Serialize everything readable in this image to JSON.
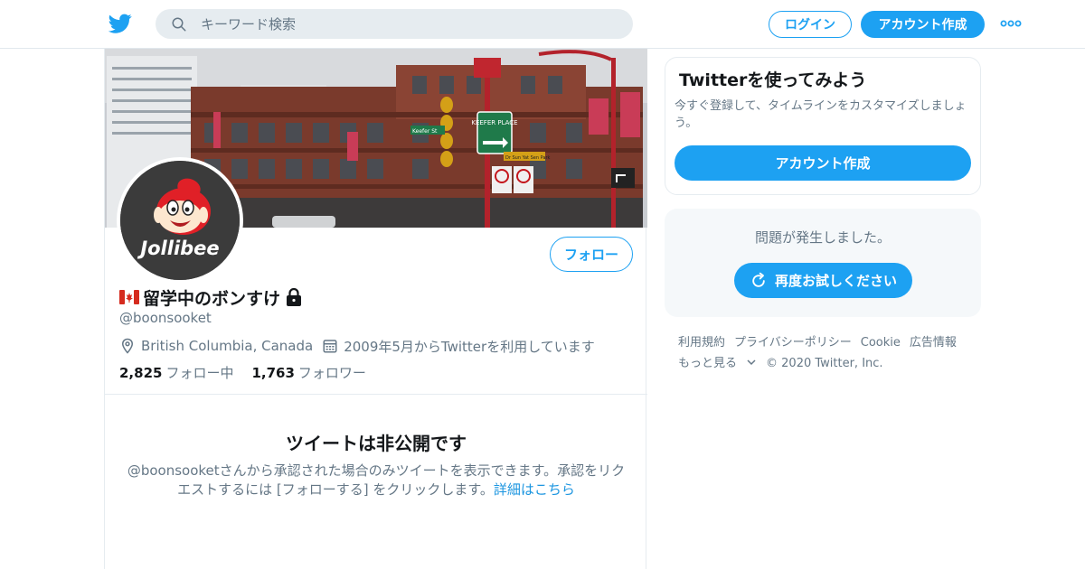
{
  "header": {
    "search_placeholder": "キーワード検索",
    "login_label": "ログイン",
    "signup_label": "アカウント作成"
  },
  "profile": {
    "display_name": "留学中のボンすけ",
    "handle": "@boonsooket",
    "location": "British Columbia, Canada",
    "joined": "2009年5月からTwitterを利用しています",
    "following_count": "2,825",
    "following_label": "フォロー中",
    "followers_count": "1,763",
    "followers_label": "フォロワー",
    "follow_label": "フォロー",
    "avatar_text": "Jollibee"
  },
  "banner_signs": {
    "street": "Keefer St",
    "place": "KEEFER PLACE",
    "park": "Dr Sun Yat Sen Park"
  },
  "protected": {
    "title": "ツイートは非公開です",
    "body": "@boonsooketさんから承認された場合のみツイートを表示できます。承認をリクエストするには [フォローする] をクリックします。",
    "link": "詳細はこちら"
  },
  "signup_card": {
    "title": "Twitterを使ってみよう",
    "body": "今すぐ登録して、タイムラインをカスタマイズしましょう。",
    "button": "アカウント作成"
  },
  "error_card": {
    "message": "問題が発生しました。",
    "button": "再度お試しください"
  },
  "footer": {
    "links": [
      "利用規約",
      "プライバシーポリシー",
      "Cookie",
      "広告情報"
    ],
    "more": "もっと見る",
    "copyright": "© 2020 Twitter, Inc."
  },
  "colors": {
    "accent": "#1da1f2",
    "secondary_text": "#657786",
    "link": "#1b95e0"
  }
}
